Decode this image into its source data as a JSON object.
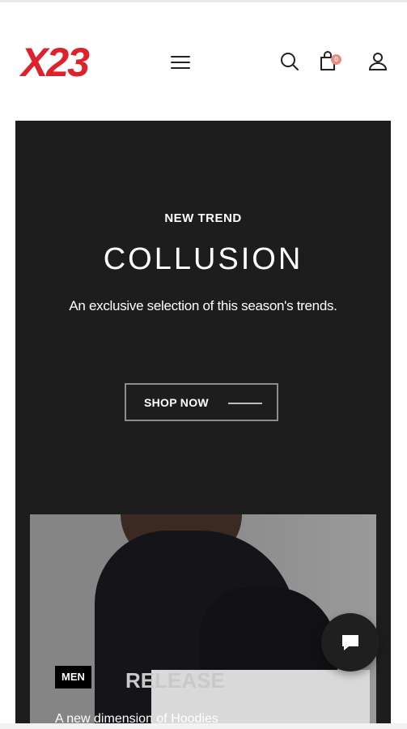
{
  "header": {
    "logo_text": "X23",
    "menu_icon": "hamburger-menu-icon",
    "search_icon": "search-icon",
    "cart_icon": "shopping-bag-icon",
    "cart_count": "0",
    "account_icon": "user-icon",
    "brand_color": "#e0212b"
  },
  "hero": {
    "eyebrow": "NEW TREND",
    "title": "COLLUSION",
    "subtitle": "An exclusive selection of this season's trends.",
    "cta_label": "SHOP NOW",
    "background_color": "#1d1d1d"
  },
  "product_card": {
    "tag": "MEN",
    "garment_print": "RELEASE",
    "caption": "A new dimension of Hoodies"
  },
  "chat": {
    "icon": "chat-bubble-icon"
  }
}
